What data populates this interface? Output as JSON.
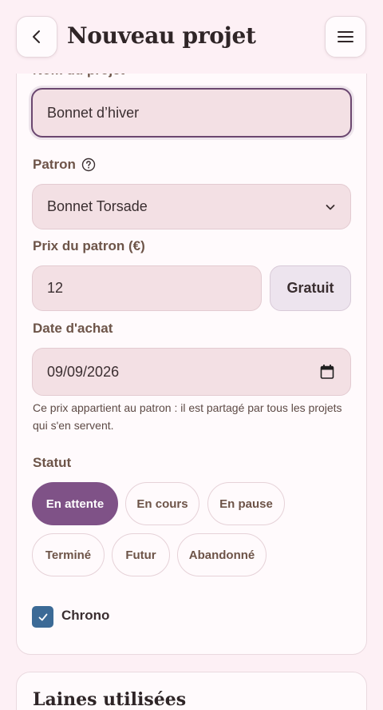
{
  "header": {
    "title": "Nouveau projet",
    "back_icon": "chevron-left-icon",
    "menu_icon": "hamburger-menu-icon"
  },
  "form": {
    "project_name_label": "Nom du projet",
    "project_name_value": "Bonnet d’hiver",
    "pattern_label": "Patron",
    "pattern_help_icon": "help-circle-icon",
    "pattern_value": "Bonnet Torsade",
    "pattern_price_label": "Prix du patron (€)",
    "pattern_price_value": "12",
    "free_button": "Gratuit",
    "purchase_date_label": "Date d'achat",
    "purchase_date_value": "09/09/2026",
    "price_hint": "Ce prix appartient au patron : il est partagé par tous les projets qui s'en servent.",
    "status_label": "Statut",
    "status_options": [
      "En attente",
      "En cours",
      "En pause",
      "Terminé",
      "Futur",
      "Abandonné"
    ],
    "status_selected": "En attente",
    "chrono_label": "Chrono",
    "chrono_checked": true
  },
  "sections": {
    "yarns_title": "Laines utilisées"
  },
  "colors": {
    "accent": "#7f5287",
    "checkbox": "#3c6a96",
    "background": "#fdf0f5"
  }
}
